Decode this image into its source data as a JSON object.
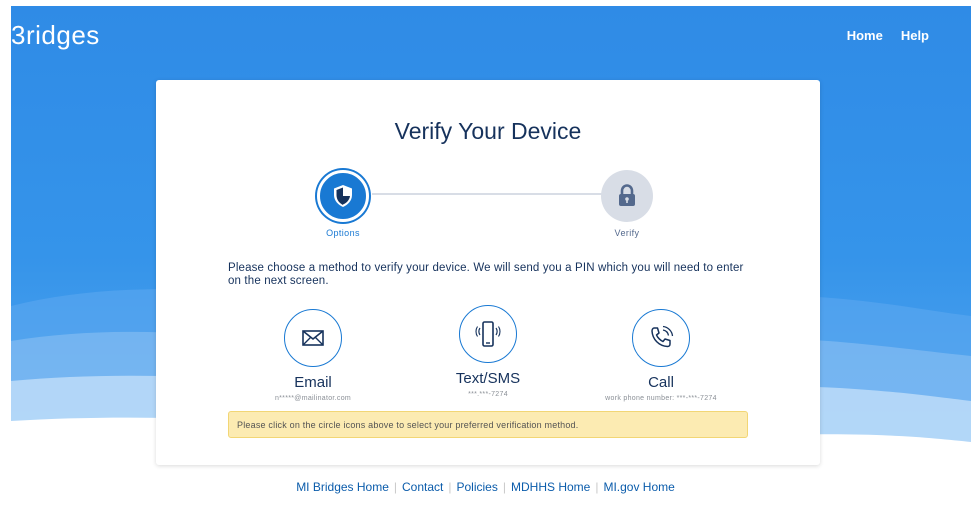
{
  "header": {
    "logo_text": "3ridges",
    "nav": [
      "Home",
      "Help"
    ]
  },
  "card": {
    "title": "Verify Your Device",
    "steps": [
      {
        "label": "Options",
        "state": "active",
        "icon": "shield-icon"
      },
      {
        "label": "Verify",
        "state": "inactive",
        "icon": "lock-icon"
      }
    ],
    "instructions": "Please choose a method to verify your device. We will send you a PIN which you will need to enter on the next screen.",
    "methods": [
      {
        "label": "Email",
        "detail": "n*****@mailinator.com",
        "icon": "envelope-icon"
      },
      {
        "label": "Text/SMS",
        "detail": "***.***-7274",
        "icon": "mobile-phone-icon"
      },
      {
        "label": "Call",
        "detail": "work phone number: ***-***-7274",
        "icon": "phone-call-icon"
      }
    ],
    "notice": "Please click on the circle icons above to select your preferred verification method."
  },
  "footer": {
    "links": [
      "MI Bridges Home",
      "Contact",
      "Policies",
      "MDHHS Home",
      "MI.gov Home"
    ]
  },
  "colors": {
    "brand_blue": "#1979d3",
    "header_blue": "#2f8be6",
    "title_navy": "#16325c",
    "notice_bg": "#fcebb2"
  }
}
